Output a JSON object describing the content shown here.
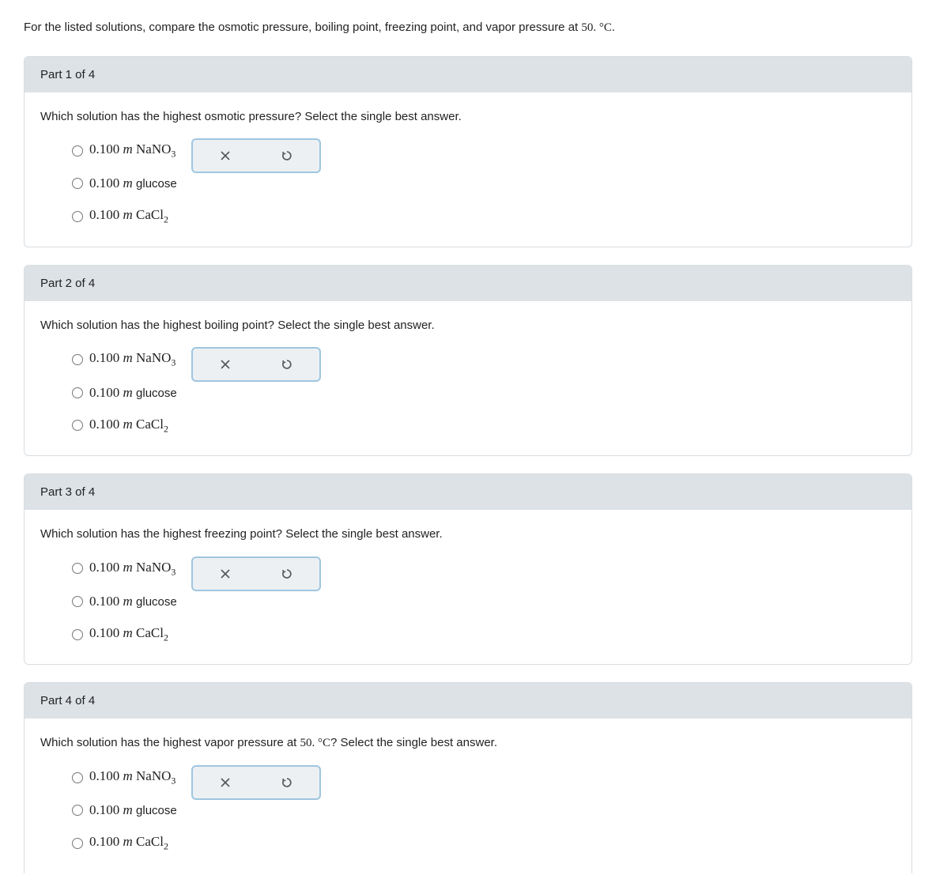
{
  "intro": {
    "prefix": "For the listed solutions, compare the osmotic pressure, boiling point, freezing point, and vapor pressure at ",
    "temp": "50. °C",
    "suffix": "."
  },
  "parts": [
    {
      "header": "Part 1 of 4",
      "question": "Which solution has the highest osmotic pressure? Select the single best answer.",
      "options": [
        {
          "value": "0.100",
          "unit": "m",
          "compound": "NaNO",
          "sub": "3"
        },
        {
          "value": "0.100",
          "unit": "m",
          "compound": "glucose",
          "sub": ""
        },
        {
          "value": "0.100",
          "unit": "m",
          "compound": "CaCl",
          "sub": "2"
        }
      ]
    },
    {
      "header": "Part 2 of 4",
      "question": "Which solution has the highest boiling point? Select the single best answer.",
      "options": [
        {
          "value": "0.100",
          "unit": "m",
          "compound": "NaNO",
          "sub": "3"
        },
        {
          "value": "0.100",
          "unit": "m",
          "compound": "glucose",
          "sub": ""
        },
        {
          "value": "0.100",
          "unit": "m",
          "compound": "CaCl",
          "sub": "2"
        }
      ]
    },
    {
      "header": "Part 3 of 4",
      "question": "Which solution has the highest freezing point? Select the single best answer.",
      "options": [
        {
          "value": "0.100",
          "unit": "m",
          "compound": "NaNO",
          "sub": "3"
        },
        {
          "value": "0.100",
          "unit": "m",
          "compound": "glucose",
          "sub": ""
        },
        {
          "value": "0.100",
          "unit": "m",
          "compound": "CaCl",
          "sub": "2"
        }
      ]
    },
    {
      "header": "Part 4 of 4",
      "question_prefix": "Which solution has the highest vapor pressure at ",
      "question_temp": "50. °C",
      "question_suffix": "? Select the single best answer.",
      "options": [
        {
          "value": "0.100",
          "unit": "m",
          "compound": "NaNO",
          "sub": "3"
        },
        {
          "value": "0.100",
          "unit": "m",
          "compound": "glucose",
          "sub": ""
        },
        {
          "value": "0.100",
          "unit": "m",
          "compound": "CaCl",
          "sub": "2"
        }
      ]
    }
  ],
  "icons": {
    "clear": "clear",
    "reset": "reset"
  }
}
